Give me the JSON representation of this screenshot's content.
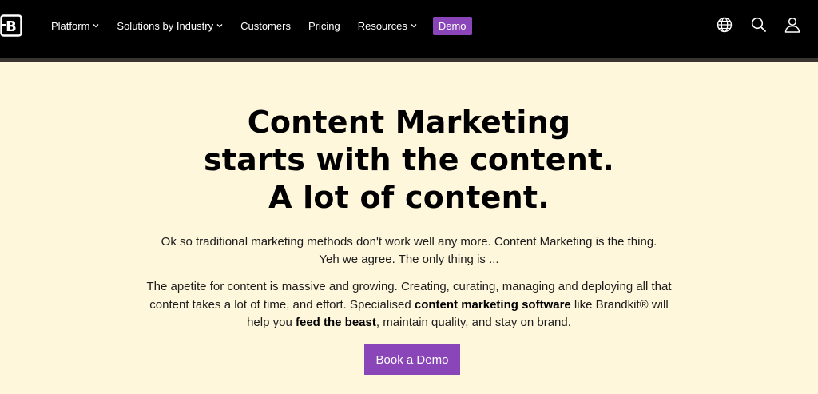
{
  "nav": {
    "logo_icon": "brandkit-logo-icon",
    "items": [
      {
        "label": "Platform",
        "has_dropdown": true
      },
      {
        "label": "Solutions by Industry",
        "has_dropdown": true
      },
      {
        "label": "Customers",
        "has_dropdown": false
      },
      {
        "label": "Pricing",
        "has_dropdown": false
      },
      {
        "label": "Resources",
        "has_dropdown": true
      }
    ],
    "demo_label": "Demo",
    "icons": [
      "globe-icon",
      "search-icon",
      "user-icon"
    ]
  },
  "hero": {
    "headline": [
      "Content Marketing",
      "starts with the content.",
      "A lot of content."
    ],
    "intro": [
      "Ok so traditional marketing methods don't work well any more. Content Marketing is the thing.",
      "Yeh we agree. The only thing is ..."
    ],
    "body": {
      "line1": "The apetite for content is massive and growing. Creating, curating, managing and deploying all that",
      "line2_a": "content takes a lot of time, and effort. Specialised ",
      "line2_b": "content marketing software",
      "line2_c": " like Brandkit® will",
      "line3_a": "help you ",
      "line3_b": "feed the beast",
      "line3_c": ", maintain quality, and stay on brand."
    },
    "cta_label": "Book a Demo"
  },
  "colors": {
    "nav_bg": "#000000",
    "hero_bg": "#fff7dc",
    "accent": "#8a45b8"
  }
}
